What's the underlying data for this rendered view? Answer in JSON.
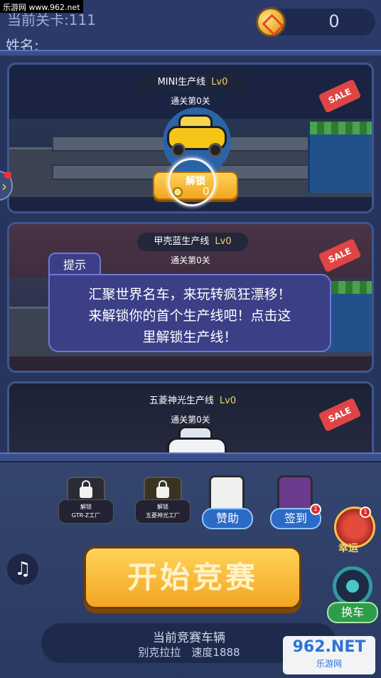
{
  "watermark": "乐游网 www.962.net",
  "header": {
    "level_label": "当前关卡:111",
    "name_label": "姓名:",
    "coins": "0"
  },
  "lines": [
    {
      "name": "MINI生产线",
      "level": "Lv0",
      "pass": "通关第0关",
      "unlock_label": "解锁",
      "price": "0",
      "sale": "SALE"
    },
    {
      "name": "甲壳蓝生产线",
      "level": "Lv0",
      "pass": "通关第0关",
      "sale": "SALE"
    },
    {
      "name": "五菱神光生产线",
      "level": "Lv0",
      "pass": "通关第0关",
      "sale": "SALE"
    }
  ],
  "tip": {
    "tab": "提示",
    "lines": [
      "汇聚世界名车，来玩转疯狂漂移！",
      "来解锁你的首个生产线吧！点击这",
      "里解锁生产线！"
    ]
  },
  "factories": [
    {
      "line1": "解锁",
      "line2": "GTR-Z工厂"
    },
    {
      "line1": "解锁",
      "line2": "五菱神光工厂"
    }
  ],
  "buttons": {
    "sponsor": "赞助",
    "checkin": "签到",
    "checkin_badge": "1",
    "luck": "幸运",
    "luck_badge": "1",
    "start": "开始竞赛",
    "swap": "换车"
  },
  "current_car": {
    "title": "当前竞赛车辆",
    "info": "别克拉拉　速度1888"
  },
  "logo": {
    "brand": "962.NET",
    "sub": "乐游网"
  },
  "colors": {
    "accent": "#f3a421",
    "panel": "#3a3f86",
    "swap": "#2e9d4a"
  }
}
